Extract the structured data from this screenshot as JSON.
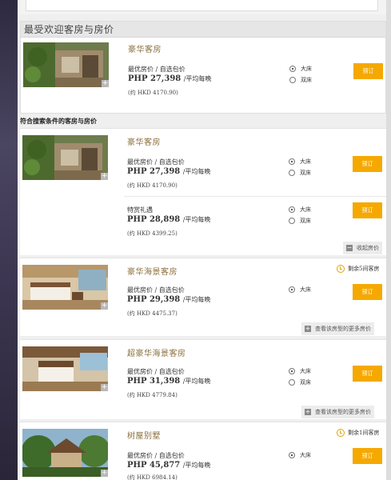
{
  "popular": {
    "heading": "最受欢迎客房与房价",
    "room": {
      "title": "豪华客房",
      "rate_label": "最优房价 / 自选包价",
      "price": "PHP 27,398",
      "unit": "/平均每晚",
      "hkd": "(约 HKD 4170.90)",
      "bed_options": [
        "大床",
        "双床"
      ],
      "selected_bed": "大床",
      "book_label": "预订"
    }
  },
  "results": {
    "heading": "符合搜索条件的客房与房价",
    "rooms": [
      {
        "title": "豪华客房",
        "rates": [
          {
            "label": "最优房价 / 自选包价",
            "price": "PHP 27,398",
            "unit": "/平均每晚",
            "hkd": "(约 HKD 4170.90)",
            "beds": [
              "大床",
              "双床"
            ],
            "book": "预订"
          },
          {
            "label": "特赏礼遇",
            "price": "PHP 28,898",
            "unit": "/平均每晚",
            "hkd": "(约 HKD 4399.25)",
            "beds": [
              "大床",
              "双床"
            ],
            "book": "预订"
          }
        ],
        "action": "收起房价"
      },
      {
        "title": "豪华海景客房",
        "availability": "剩余5间客房",
        "rates": [
          {
            "label": "最优房价 / 自选包价",
            "price": "PHP 29,398",
            "unit": "/平均每晚",
            "hkd": "(约 HKD 4475.37)",
            "beds": [
              "大床"
            ],
            "book": "预订"
          }
        ],
        "action": "查看该房型的更多房价"
      },
      {
        "title": "超豪华海景客房",
        "rates": [
          {
            "label": "最优房价 / 自选包价",
            "price": "PHP 31,398",
            "unit": "/平均每晚",
            "hkd": "(约 HKD 4779.84)",
            "beds": [
              "大床",
              "双床"
            ],
            "book": "预订"
          }
        ],
        "action": "查看该房型的更多房价"
      },
      {
        "title": "树屋别墅",
        "availability": "剩余1间客房",
        "rates": [
          {
            "label": "最优房价 / 自选包价",
            "price": "PHP 45,877",
            "unit": "/平均每晚",
            "hkd": "(约 HKD 6984.14)",
            "beds": [
              "大床"
            ],
            "book": "预订"
          }
        ]
      }
    ]
  },
  "colors": {
    "accent_button": "#f5a900",
    "title_gold": "#8a6d3b"
  }
}
